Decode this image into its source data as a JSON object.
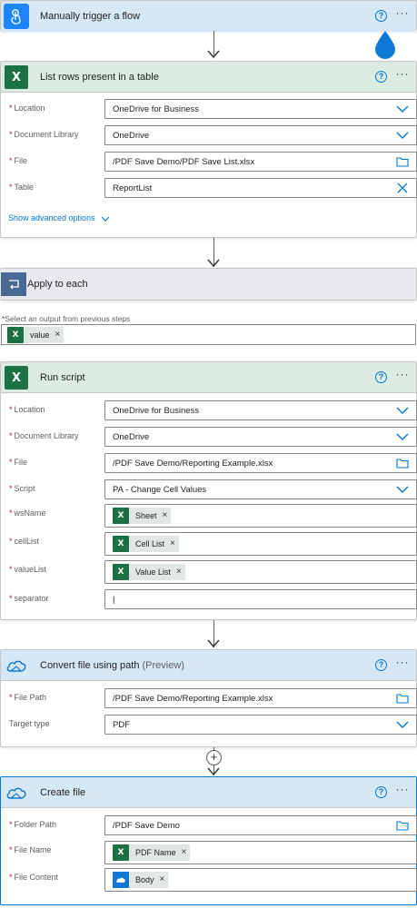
{
  "trigger": {
    "title": "Manually trigger a flow",
    "help": "?",
    "more": "···"
  },
  "list_rows": {
    "title": "List rows present in a table",
    "help": "?",
    "more": "···",
    "fields": [
      {
        "label": "Location",
        "value": "OneDrive for Business",
        "control": "dropdown"
      },
      {
        "label": "Document Library",
        "value": "OneDrive",
        "control": "dropdown"
      },
      {
        "label": "File",
        "value": "/PDF Save Demo/PDF Save List.xlsx",
        "control": "folder"
      },
      {
        "label": "Table",
        "value": "ReportList",
        "control": "clear"
      }
    ],
    "advanced": "Show advanced options"
  },
  "apply_each": {
    "title": "Apply to each",
    "select_label": "Select an output from previous steps",
    "token": "value"
  },
  "run_script": {
    "title": "Run script",
    "help": "?",
    "more": "···",
    "fields": [
      {
        "label": "Location",
        "value": "OneDrive for Business",
        "control": "dropdown"
      },
      {
        "label": "Document Library",
        "value": "OneDrive",
        "control": "dropdown"
      },
      {
        "label": "File",
        "value": "/PDF Save Demo/Reporting Example.xlsx",
        "control": "folder"
      },
      {
        "label": "Script",
        "value": "PA - Change Cell Values",
        "control": "dropdown"
      },
      {
        "label": "wsName",
        "token": "Sheet"
      },
      {
        "label": "cellList",
        "token": "Cell List"
      },
      {
        "label": "valueList",
        "token": "Value List"
      },
      {
        "label": "separator",
        "value": "|"
      }
    ]
  },
  "convert_file": {
    "title": "Convert file using path",
    "suffix": "(Preview)",
    "help": "?",
    "more": "···",
    "fields": [
      {
        "label": "File Path",
        "value": "/PDF Save Demo/Reporting Example.xlsx",
        "control": "folder",
        "required": true
      },
      {
        "label": "Target type",
        "value": "PDF",
        "control": "dropdown",
        "required": false
      }
    ]
  },
  "create_file": {
    "title": "Create file",
    "help": "?",
    "more": "···",
    "fields": [
      {
        "label": "Folder Path",
        "value": "/PDF Save Demo",
        "control": "folder"
      },
      {
        "label": "File Name",
        "token": "PDF Name"
      },
      {
        "label": "File Content",
        "token": "Body"
      }
    ]
  },
  "colors": {
    "accent": "#0078d4",
    "excel": "#1e7145",
    "required": "#a4262c",
    "onedrive": "#0f78d4"
  }
}
